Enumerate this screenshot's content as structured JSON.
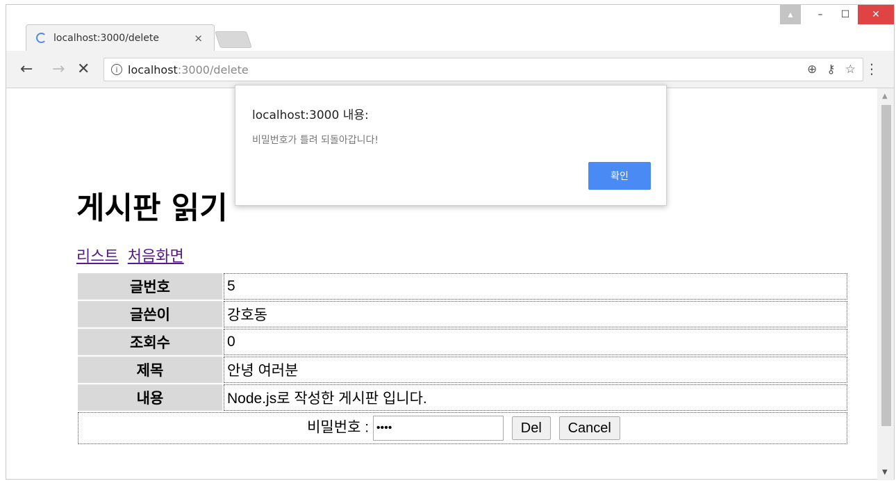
{
  "browser": {
    "tab_title": "localhost:3000/delete",
    "tab_close": "×",
    "window_controls": {
      "user": "▴",
      "minimize": "–",
      "maximize": "☐",
      "close": "✕"
    },
    "nav": {
      "back": "←",
      "forward": "→",
      "stop": "✕"
    },
    "url_host": "localhost",
    "url_path": ":3000/delete",
    "info_icon": "i",
    "omnibox_icons": {
      "zoom": "⊕",
      "key": "⚷",
      "star": "☆"
    },
    "menu": "⋮"
  },
  "page": {
    "title": "게시판 읽기",
    "links": [
      "리스트",
      "처음화면"
    ],
    "table": [
      {
        "label": "글번호",
        "value": "5"
      },
      {
        "label": "글쓴이",
        "value": "강호동"
      },
      {
        "label": "조회수",
        "value": "0"
      },
      {
        "label": "제목",
        "value": "안녕 여러분"
      },
      {
        "label": "내용",
        "value": "Node.js로 작성한 게시판 입니다."
      }
    ],
    "password_label": "비밀번호 :",
    "password_value": "••••",
    "del_button": "Del",
    "cancel_button": "Cancel"
  },
  "dialog": {
    "title": "localhost:3000 내용:",
    "message": "비밀번호가 틀려 되돌아갑니다!",
    "ok_label": "확인",
    "ok_color": "#4a8af4"
  }
}
